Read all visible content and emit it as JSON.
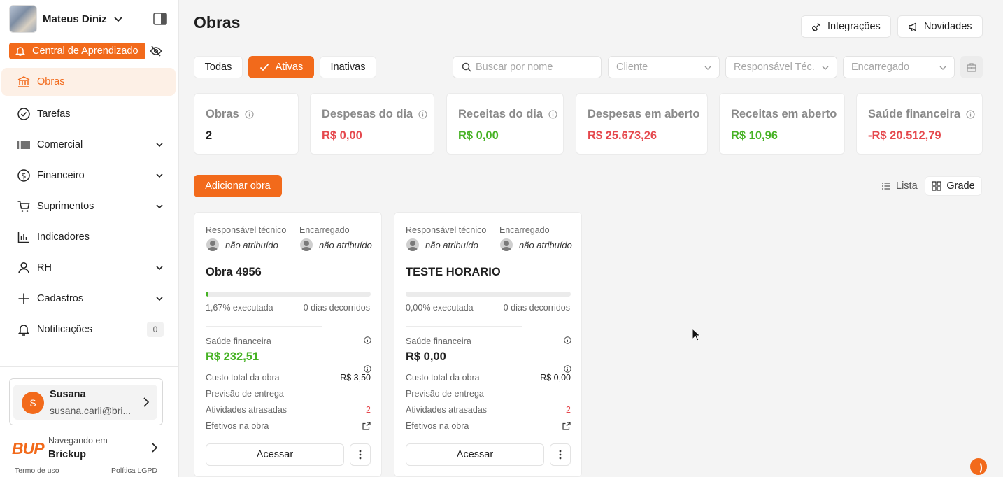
{
  "user": {
    "name": "Mateus Diniz"
  },
  "learning": {
    "label": "Central de Aprendizado"
  },
  "nav": [
    {
      "label": "Obras",
      "icon": "bank-icon"
    },
    {
      "label": "Tarefas",
      "icon": "check-circle-icon"
    },
    {
      "label": "Comercial",
      "icon": "barcode-icon"
    },
    {
      "label": "Financeiro",
      "icon": "dollar-circle-icon"
    },
    {
      "label": "Suprimentos",
      "icon": "cart-icon"
    },
    {
      "label": "Indicadores",
      "icon": "bar-chart-icon"
    },
    {
      "label": "RH",
      "icon": "person-icon"
    },
    {
      "label": "Cadastros",
      "icon": "plus-icon"
    },
    {
      "label": "Notificações",
      "icon": "bell-icon",
      "count": "0"
    }
  ],
  "account": {
    "initial": "S",
    "name": "Susana",
    "email": "susana.carli@bri..."
  },
  "company": {
    "logo": "BUP",
    "label": "Navegando em",
    "name": "Brickup"
  },
  "footer": {
    "terms": "Termo de uso",
    "privacy": "Política LGPD"
  },
  "page": {
    "title": "Obras"
  },
  "top_buttons": {
    "integrations": "Integrações",
    "news": "Novidades"
  },
  "tabs": {
    "all": "Todas",
    "active": "Ativas",
    "inactive": "Inativas"
  },
  "filters": {
    "search_placeholder": "Buscar por nome",
    "client": "Cliente",
    "tech": "Responsável Téc.",
    "foreman": "Encarregado"
  },
  "stats": {
    "obras": {
      "label": "Obras",
      "value": "2"
    },
    "despesas_dia": {
      "label": "Despesas do dia",
      "value": "R$ 0,00"
    },
    "receitas_dia": {
      "label": "Receitas do dia",
      "value": "R$ 0,00"
    },
    "despesas_aberto": {
      "label": "Despesas em aberto",
      "value": "R$ 25.673,26"
    },
    "receitas_aberto": {
      "label": "Receitas em aberto",
      "value": "R$ 10,96"
    },
    "saude": {
      "label": "Saúde financeira",
      "value": "-R$ 20.512,79"
    }
  },
  "actions": {
    "add": "Adicionar obra",
    "list": "Lista",
    "grid": "Grade"
  },
  "card_labels": {
    "tech": "Responsável técnico",
    "foreman": "Encarregado",
    "unassigned": "não atribuído",
    "health": "Saúde financeira",
    "total_cost": "Custo total da obra",
    "delivery": "Previsão de entrega",
    "late": "Atividades atrasadas",
    "staff": "Efetivos na obra",
    "access": "Acessar"
  },
  "cards": [
    {
      "title": "Obra 4956",
      "progress": 0.0167,
      "executed": "1,67% executada",
      "days": "0 dias decorridos",
      "health": "R$ 232,51",
      "total_cost": "R$ 3,50",
      "delivery": "-",
      "late": "2"
    },
    {
      "title": "TESTE HORARIO",
      "progress": 0.0,
      "executed": "0,00% executada",
      "days": "0 dias decorridos",
      "health": "R$ 0,00",
      "total_cost": "R$ 0,00",
      "delivery": "-",
      "late": "2"
    }
  ],
  "colors": {
    "accent": "#f26a1b",
    "negative": "#e5484d",
    "positive": "#46b224"
  }
}
